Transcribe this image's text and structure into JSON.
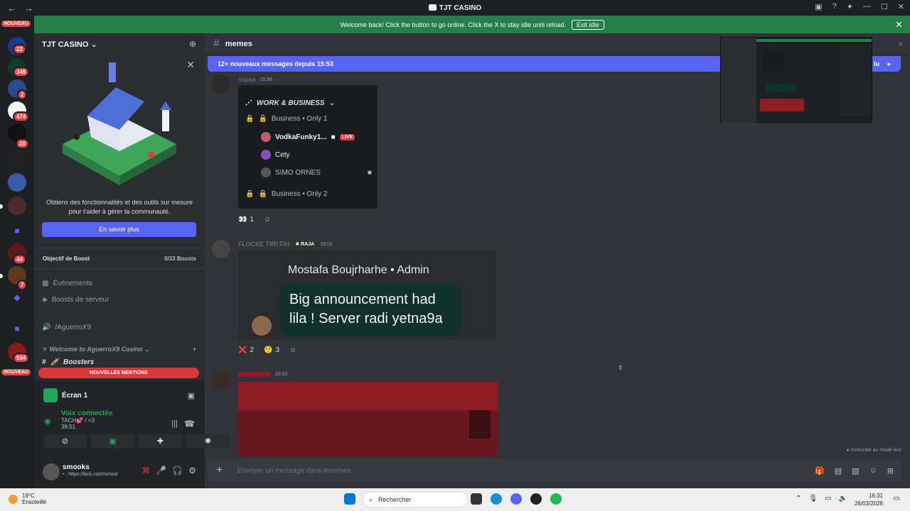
{
  "window": {
    "title": "TJT CASINO",
    "back": "←",
    "forward": "→"
  },
  "banner": {
    "text": "Welcome back! Click the button to go online. Click the X to stay idle until reload.",
    "exit_label": "Exit idle",
    "close": "✕"
  },
  "guilds": {
    "new_label": "NOUVEAU",
    "badges": [
      "22",
      "349",
      "2",
      "474",
      "20",
      "44",
      "7",
      "594"
    ]
  },
  "server": {
    "name": "TJT CASINO",
    "chevron": "⌄"
  },
  "promo": {
    "text": "Obtiens des fonctionnalités et des outils sur mesure pour t'aider à gérer ta communauté.",
    "button": "En savoir plus"
  },
  "boost": {
    "label": "Objectif de Boost",
    "value": "0/33 Boosts"
  },
  "channels": {
    "events": "Événements",
    "server_boosts": "Boosts de serveur",
    "voice_channel": "/AguerroX9",
    "category": "Welcome to AguerroX9 Casino",
    "boosters": "Boosters"
  },
  "mentions_label": "NOUVELLES MENTIONS",
  "stream": {
    "title": "Écran 1"
  },
  "voice": {
    "status": "Voix connectée",
    "channel": "TACH💕 / <3",
    "timer": "38:51"
  },
  "user": {
    "name": "smooks",
    "status": "• : https://kick.com/smool"
  },
  "chat": {
    "channel": "memes",
    "new_messages": "12+ nouveaux messages depuis 15:53",
    "mark_read": "lu",
    "messages": [
      {
        "author": "sapaa",
        "time": "15:58",
        "embed": {
          "category": "WORK & BUSINESS",
          "row1": "Business • Only 1",
          "user1": "VodkaFunky1...",
          "live": "LIVE",
          "user2": "Cety",
          "user3": "SIMO ORNES",
          "row2": "Business • Only 2"
        },
        "reaction": {
          "emoji": "👀",
          "count": "1"
        }
      },
      {
        "author": "FLOCKE TIRI FIH",
        "tag": "RAJA",
        "time": "16:01",
        "embed": {
          "title": "Mostafa Boujrharhe • Admin",
          "bubble": "Big announcement had lila ! Server radi yetna9a"
        },
        "reactions": [
          {
            "emoji": "❌",
            "count": "2"
          },
          {
            "emoji": "🤨",
            "count": "3"
          }
        ]
      },
      {
        "author": "",
        "time": "16:02"
      }
    ]
  },
  "composer": {
    "placeholder": "Envoyer un message dans #memes"
  },
  "immunity": "Immunité au mode lent",
  "taskbar": {
    "temp": "19°C",
    "weather": "Ensoleillé",
    "search": "Rechercher",
    "time": "16:31",
    "date": "26/03/2026"
  },
  "colors": {
    "accent": "#5865f2",
    "banner": "#248046",
    "danger": "#da373c",
    "online": "#23a55a"
  }
}
